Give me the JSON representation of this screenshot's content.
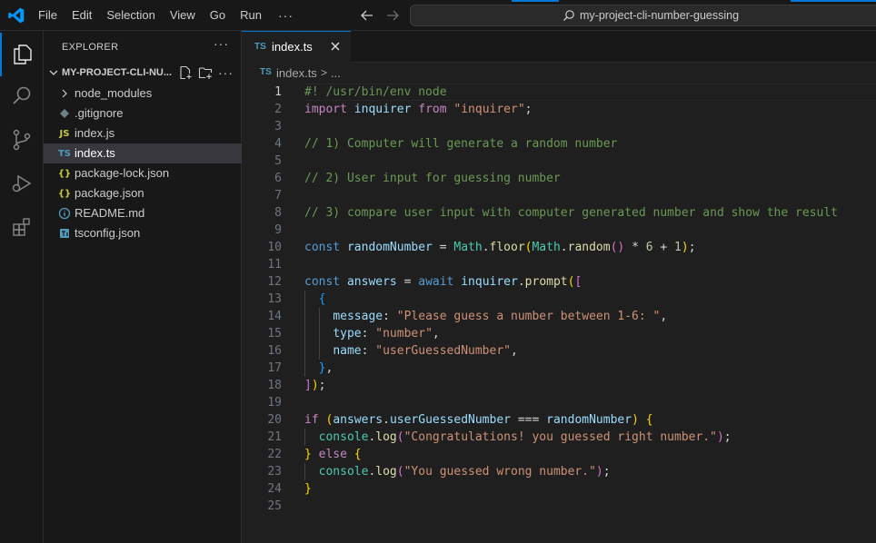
{
  "titlebar": {
    "menu": [
      "File",
      "Edit",
      "Selection",
      "View",
      "Go",
      "Run"
    ],
    "more": "···",
    "search_text": "my-project-cli-number-guessing"
  },
  "sidebar": {
    "title": "EXPLORER",
    "more": "···",
    "folder_name": "MY-PROJECT-CLI-NU...",
    "folder_more": "···",
    "items": [
      {
        "label": "node_modules",
        "icon": "chevron-right-icon"
      },
      {
        "label": ".gitignore",
        "icon": "git-icon"
      },
      {
        "label": "index.js",
        "icon": "js-file-icon",
        "icon_text": "JS"
      },
      {
        "label": "index.ts",
        "icon": "ts-file-icon",
        "icon_text": "TS"
      },
      {
        "label": "package-lock.json",
        "icon": "json-file-icon",
        "icon_text": "{}"
      },
      {
        "label": "package.json",
        "icon": "json-file-icon",
        "icon_text": "{}"
      },
      {
        "label": "README.md",
        "icon": "info-icon",
        "icon_text": "i"
      },
      {
        "label": "tsconfig.json",
        "icon": "tsconfig-icon",
        "icon_text": "TS"
      }
    ],
    "selected_item": "index.ts"
  },
  "tab": {
    "icon_text": "TS",
    "label": "index.ts"
  },
  "breadcrumb": {
    "icon_text": "TS",
    "file": "index.ts",
    "sep": ">",
    "rest": "..."
  },
  "editor": {
    "active_line": 1,
    "lines": [
      "#! /usr/bin/env node",
      "import inquirer from \"inquirer\";",
      "",
      "// 1) Computer will generate a random number",
      "",
      "// 2) User input for guessing number",
      "",
      "// 3) compare user input with computer generated number and show the result",
      "",
      "const randomNumber = Math.floor(Math.random() * 6 + 1);",
      "",
      "const answers = await inquirer.prompt([",
      "  {",
      "    message: \"Please guess a number between 1-6: \",",
      "    type: \"number\",",
      "    name: \"userGuessedNumber\",",
      "  },",
      "]);",
      "",
      "if (answers.userGuessedNumber === randomNumber) {",
      "  console.log(\"Congratulations! you guessed right number.\");",
      "} else {",
      "  console.log(\"You guessed wrong number.\");",
      "}",
      ""
    ]
  },
  "colors": {
    "accent": "#0078d4",
    "background": "#1f1f1f",
    "sidebar": "#181818"
  }
}
